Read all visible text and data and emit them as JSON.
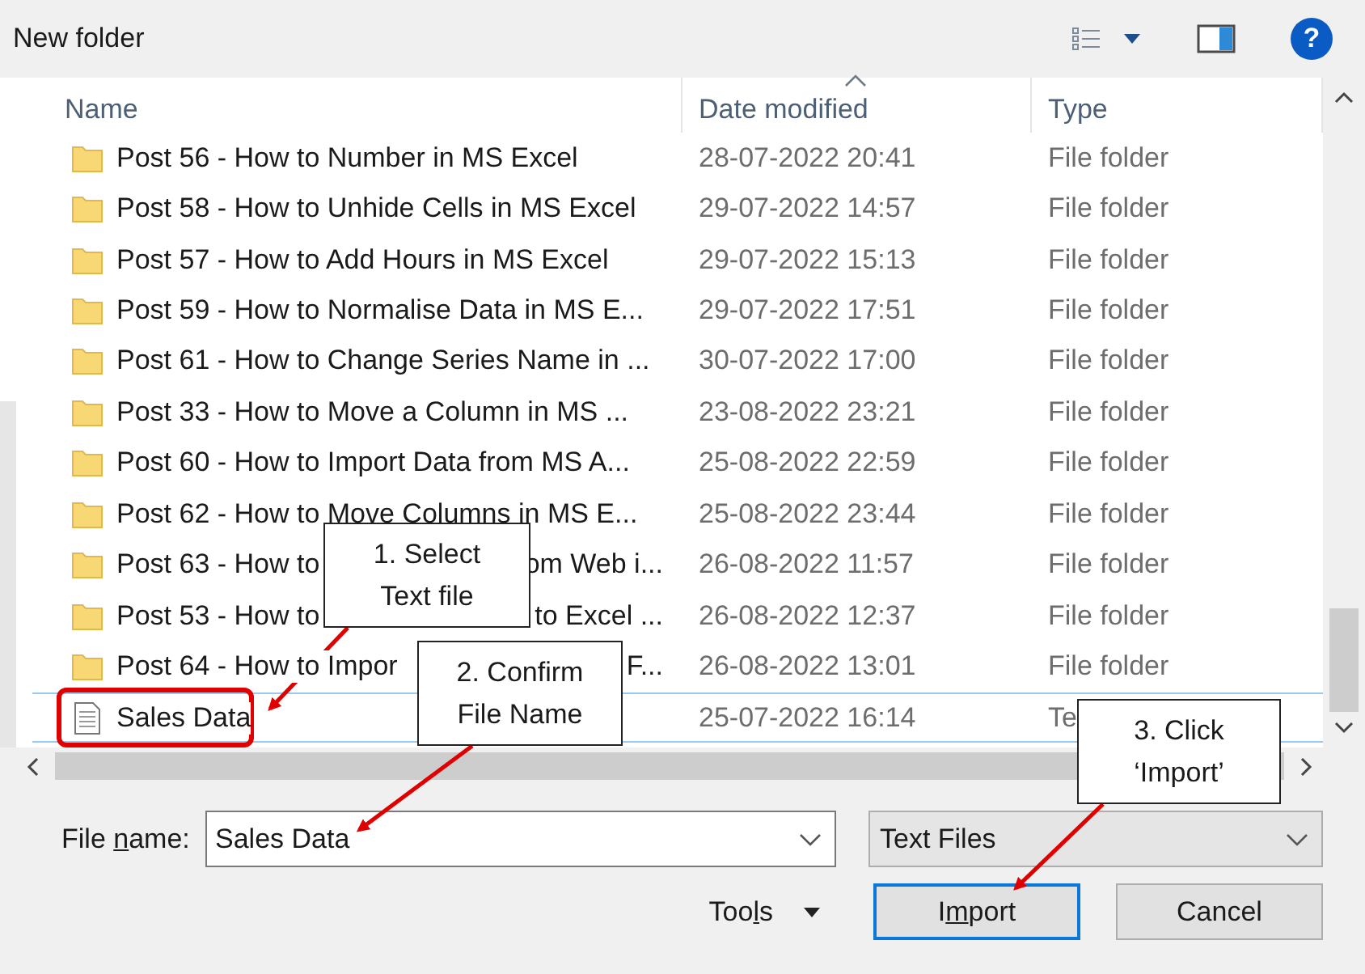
{
  "window": {
    "title": "New folder"
  },
  "help": {
    "label": "?"
  },
  "columns": [
    {
      "label": "Name",
      "sorted": false
    },
    {
      "label": "Date modified",
      "sorted": true
    },
    {
      "label": "Type",
      "sorted": false
    }
  ],
  "rows": [
    {
      "kind": "folder",
      "name": "Post 56 - How to Number in MS Excel",
      "date": "28-07-2022 20:41",
      "type": "File folder",
      "selected": false
    },
    {
      "kind": "folder",
      "name": "Post 58 - How to Unhide Cells in MS Excel",
      "date": "29-07-2022 14:57",
      "type": "File folder",
      "selected": false
    },
    {
      "kind": "folder",
      "name": "Post 57 - How to Add Hours in MS Excel",
      "date": "29-07-2022 15:13",
      "type": "File folder",
      "selected": false
    },
    {
      "kind": "folder",
      "name": "Post 59 - How to Normalise Data in MS E...",
      "date": "29-07-2022 17:51",
      "type": "File folder",
      "selected": false
    },
    {
      "kind": "folder",
      "name": "Post 61 - How to Change Series Name in ...",
      "date": "30-07-2022 17:00",
      "type": "File folder",
      "selected": false
    },
    {
      "kind": "folder",
      "name": "Post 33 - How to Move a Column in MS ...",
      "date": "23-08-2022 23:21",
      "type": "File folder",
      "selected": false
    },
    {
      "kind": "folder",
      "name": "Post 60 - How to Import Data from MS A...",
      "date": "25-08-2022 22:59",
      "type": "File folder",
      "selected": false
    },
    {
      "kind": "folder",
      "name": "Post 62 - How to Move Columns in MS E...",
      "date": "25-08-2022 23:44",
      "type": "File folder",
      "selected": false
    },
    {
      "kind": "folder",
      "name": "Post 63 - How to",
      "name_tail": "om Web i...",
      "date": "26-08-2022 11:57",
      "type": "File folder",
      "selected": false
    },
    {
      "kind": "folder",
      "name": "Post 53 - How to",
      "name_tail": "to Excel ...",
      "date": "26-08-2022 12:37",
      "type": "File folder",
      "selected": false
    },
    {
      "kind": "folder",
      "name": "Post 64 - How to Impor",
      "name_tail": "F...",
      "date": "26-08-2022 13:01",
      "type": "File folder",
      "selected": false
    },
    {
      "kind": "text",
      "name": "Sales Data",
      "date": "25-07-2022 16:14",
      "type": "Te",
      "selected": true
    }
  ],
  "file_name": {
    "label": {
      "before": "File ",
      "key": "n",
      "after": "ame:"
    },
    "value": "Sales Data"
  },
  "file_type": {
    "value": "Text Files"
  },
  "tools": {
    "before": "Too",
    "key": "l",
    "after": "s"
  },
  "buttons": [
    {
      "before": "I",
      "key": "m",
      "after": "port",
      "default": true
    },
    {
      "before": "Cancel",
      "default": false
    }
  ],
  "callouts": [
    {
      "text": "1. Select\nText file"
    },
    {
      "text": "2. Confirm\nFile Name"
    },
    {
      "text": "3. Click\n‘Import’"
    }
  ]
}
